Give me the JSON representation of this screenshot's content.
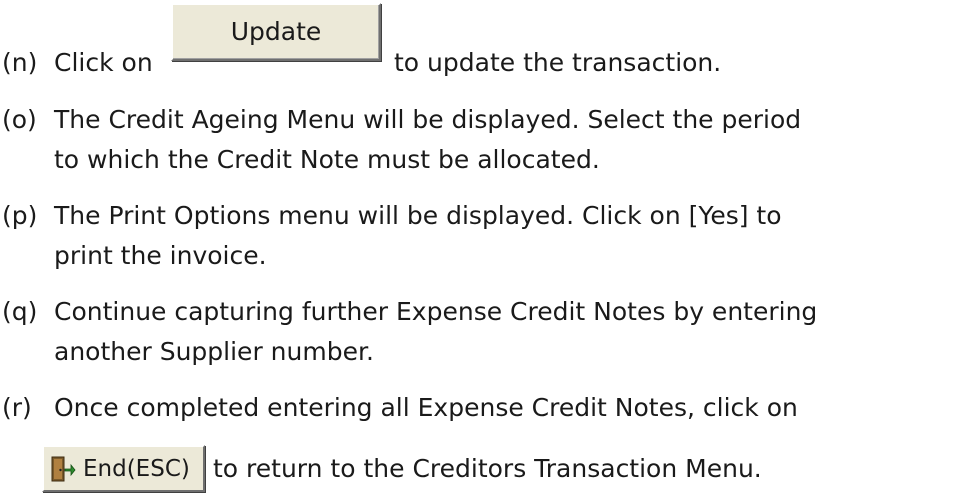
{
  "items": [
    {
      "label": "(n)",
      "before": "Click on",
      "after": "to update the transaction."
    },
    {
      "label": "(o)",
      "line1": "The Credit Ageing Menu will be displayed.  Select the period",
      "line2": "to which the Credit Note must be allocated."
    },
    {
      "label": "(p)",
      "line1": "The Print Options menu will be displayed. Click on [Yes] to",
      "line2": "print the invoice."
    },
    {
      "label": "(q)",
      "line1": "Continue capturing further Expense Credit Notes by entering",
      "line2": "another Supplier number."
    },
    {
      "label": "(r)",
      "line1": "Once completed entering all Expense Credit Notes, click on",
      "after": "to return to the Creditors Transaction Menu."
    }
  ],
  "buttons": {
    "update_label": "Update",
    "end_label": "End(ESC)",
    "end_icon": "exit-door-icon"
  }
}
